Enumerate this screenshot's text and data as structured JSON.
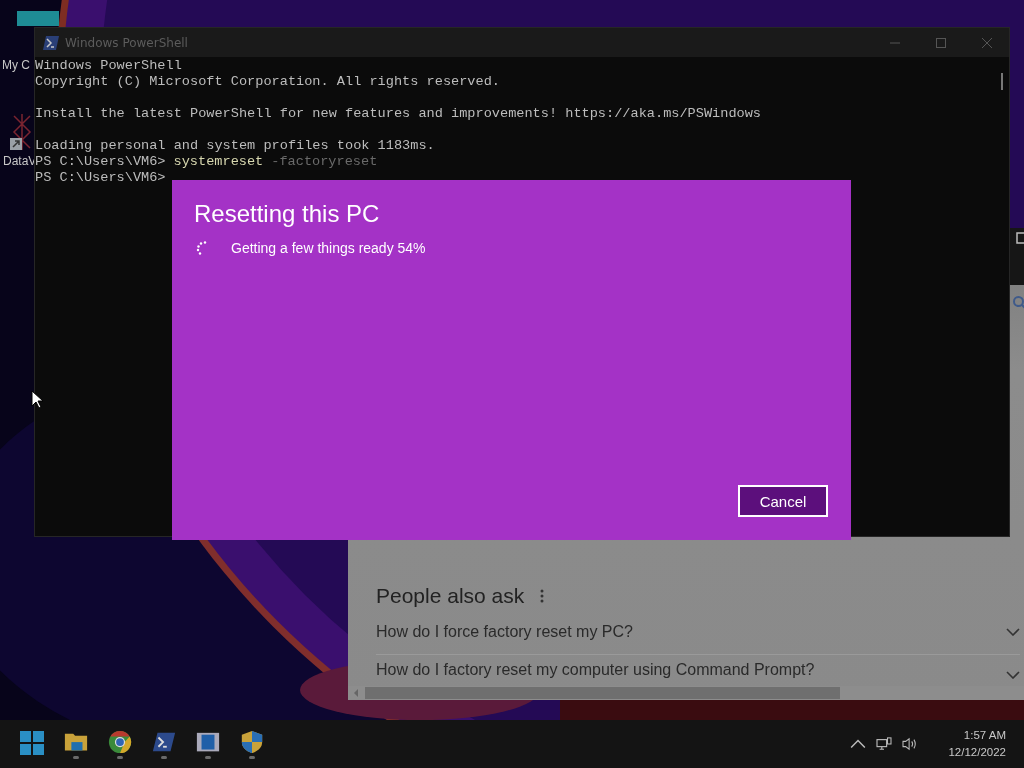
{
  "desktop_icons": [
    {
      "label": "My C",
      "kind": "computer"
    },
    {
      "label": "DataV",
      "kind": "shortcut"
    }
  ],
  "browser": {
    "section_title": "People also ask",
    "questions": [
      {
        "text": "How do I force factory reset my PC?"
      },
      {
        "text": "How do I factory reset my computer using Command Prompt?"
      }
    ]
  },
  "console": {
    "title": "Windows PowerShell",
    "lines": [
      {
        "kind": "output",
        "text": "Windows PowerShell"
      },
      {
        "kind": "output",
        "text": "Copyright (C) Microsoft Corporation. All rights reserved."
      },
      {
        "kind": "blank"
      },
      {
        "kind": "output",
        "text": "Install the latest PowerShell for new features and improvements! https://aka.ms/PSWindows"
      },
      {
        "kind": "blank"
      },
      {
        "kind": "output",
        "text": "Loading personal and system profiles took 1183ms."
      },
      {
        "kind": "prompt",
        "prompt": "PS C:\\Users\\VM6>",
        "command": "systemreset",
        "argument": "-factoryreset"
      },
      {
        "kind": "prompt",
        "prompt": "PS C:\\Users\\VM6>"
      }
    ]
  },
  "dialog": {
    "title": "Resetting this PC",
    "status": "Getting a few things ready 54%",
    "buttons": [
      {
        "label": "Cancel"
      }
    ]
  },
  "taskbar": {
    "apps": [
      {
        "kind": "start"
      },
      {
        "kind": "explorer"
      },
      {
        "kind": "chrome"
      },
      {
        "kind": "powershell"
      },
      {
        "kind": "media"
      },
      {
        "kind": "shield"
      }
    ],
    "time": "1:57 AM",
    "date": "12/12/2022"
  }
}
